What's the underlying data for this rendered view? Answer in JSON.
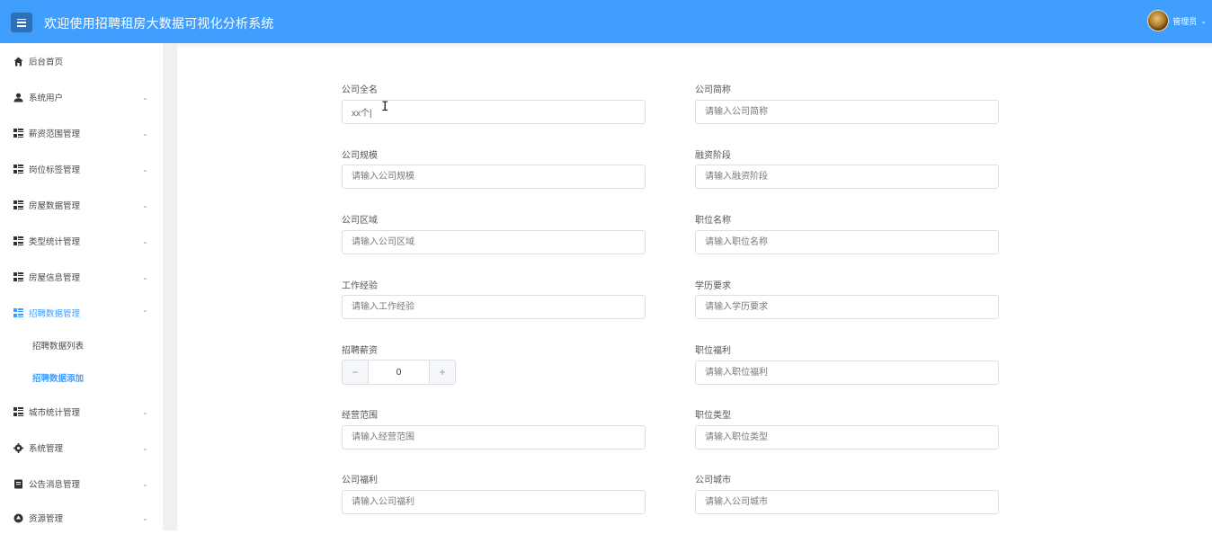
{
  "header": {
    "title": "欢迎使用招聘租房大数据可视化分析系统",
    "user": "管理员"
  },
  "sidebar": {
    "items": [
      {
        "label": "后台首页"
      },
      {
        "label": "系统用户"
      },
      {
        "label": "薪资范围管理"
      },
      {
        "label": "岗位标签管理"
      },
      {
        "label": "房屋数据管理"
      },
      {
        "label": "类型统计管理"
      },
      {
        "label": "房屋信息管理"
      },
      {
        "label": "招聘数据管理"
      },
      {
        "label": "城市统计管理"
      },
      {
        "label": "系统管理"
      },
      {
        "label": "公告消息管理"
      },
      {
        "label": "资源管理"
      }
    ],
    "sub_items": [
      {
        "label": "招聘数据列表"
      },
      {
        "label": "招聘数据添加"
      }
    ]
  },
  "form": {
    "fields": [
      {
        "label": "公司全名",
        "value": "xx个|",
        "placeholder": ""
      },
      {
        "label": "公司简称",
        "value": "",
        "placeholder": "请输入公司简称"
      },
      {
        "label": "公司规模",
        "value": "",
        "placeholder": "请输入公司规模"
      },
      {
        "label": "融资阶段",
        "value": "",
        "placeholder": "请输入融资阶段"
      },
      {
        "label": "公司区域",
        "value": "",
        "placeholder": "请输入公司区域"
      },
      {
        "label": "职位名称",
        "value": "",
        "placeholder": "请输入职位名称"
      },
      {
        "label": "工作经验",
        "value": "",
        "placeholder": "请输入工作经验"
      },
      {
        "label": "学历要求",
        "value": "",
        "placeholder": "请输入学历要求"
      },
      {
        "label": "招聘薪资",
        "value": "0"
      },
      {
        "label": "职位福利",
        "value": "",
        "placeholder": "请输入职位福利"
      },
      {
        "label": "经营范围",
        "value": "",
        "placeholder": "请输入经营范围"
      },
      {
        "label": "职位类型",
        "value": "",
        "placeholder": "请输入职位类型"
      },
      {
        "label": "公司福利",
        "value": "",
        "placeholder": "请输入公司福利"
      },
      {
        "label": "公司城市",
        "value": "",
        "placeholder": "请输入公司城市"
      }
    ],
    "stepper": {
      "minus": "−",
      "plus": "+"
    }
  },
  "colors": {
    "header_bg": "#409eff",
    "active": "#409eff"
  }
}
